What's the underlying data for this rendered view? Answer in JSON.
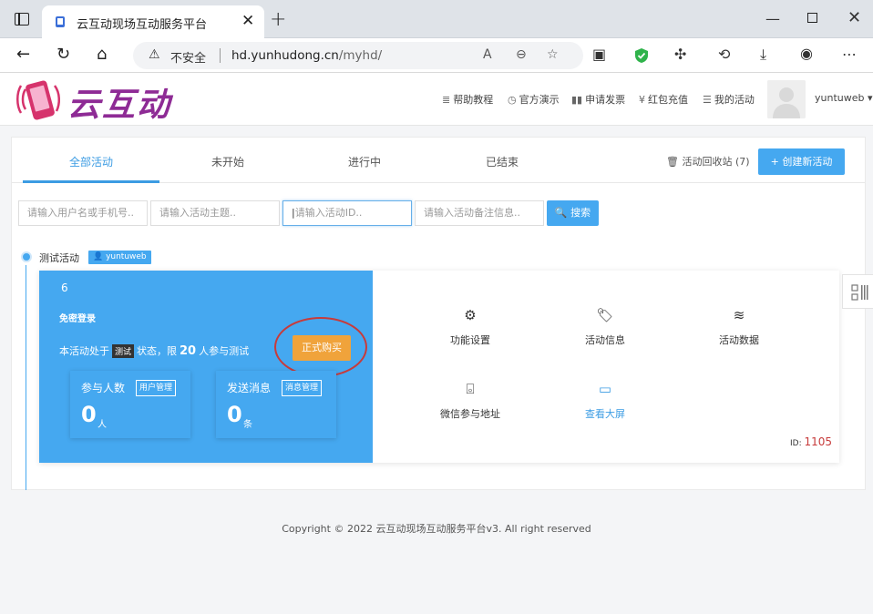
{
  "browser": {
    "tab_title": "云互动现场互动服务平台",
    "insecure_label": "不安全",
    "url_host": "hd.yunhudong.cn",
    "url_path": "/myhd/"
  },
  "header": {
    "logo_text": "云互动",
    "nav": [
      {
        "icon": "≣",
        "label": "帮助教程"
      },
      {
        "icon": "◷",
        "label": "官方演示"
      },
      {
        "icon": "▮▮",
        "label": "申请发票"
      },
      {
        "icon": "¥",
        "label": "红包充值"
      },
      {
        "icon": "☰",
        "label": "我的活动"
      }
    ],
    "username": "yuntuweb ▾"
  },
  "filter_tabs": [
    {
      "label": "全部活动",
      "active": true
    },
    {
      "label": "未开始",
      "active": false
    },
    {
      "label": "进行中",
      "active": false
    },
    {
      "label": "已结束",
      "active": false
    }
  ],
  "recycle": "🗑 活动回收站 (7)",
  "create_button": "+ 创建新活动",
  "search": {
    "placeholders": [
      "请输入用户名或手机号..",
      "请输入活动主题..",
      "请输入活动ID..",
      "请输入活动备注信息.."
    ],
    "button": "🔍 搜索"
  },
  "group": {
    "title": "测试活动",
    "user": "👤 yuntuweb"
  },
  "activity": {
    "title": "6",
    "subtitle": "免密登录",
    "status_prefix": "本活动处于",
    "status_badge": "测试",
    "status_mid": "状态，限",
    "limit": "20",
    "status_suffix": "人参与测试",
    "buy_button": "正式购买",
    "participants_label": "参与人数",
    "participants_tag": "用户管理",
    "participants_value": "0",
    "participants_unit": "人",
    "messages_label": "发送消息",
    "messages_tag": "消息管理",
    "messages_value": "0",
    "messages_unit": "条",
    "functions": [
      {
        "icon": "⚙",
        "label": "功能设置"
      },
      {
        "icon": "🏷",
        "label": "活动信息"
      },
      {
        "icon": "≋",
        "label": "活动数据"
      },
      {
        "icon": "⌻",
        "label": "微信参与地址"
      },
      {
        "icon": "▭",
        "label": "查看大屏"
      }
    ],
    "id_label": "ID:",
    "id_value": "1105"
  },
  "footer": "Copyright © 2022 云互动现场互动服务平台v3. All right reserved",
  "colors": {
    "primary": "#45a8f0",
    "buy": "#f0a33b",
    "highlight": "#c73b3b",
    "logo": "#8e2b95"
  }
}
